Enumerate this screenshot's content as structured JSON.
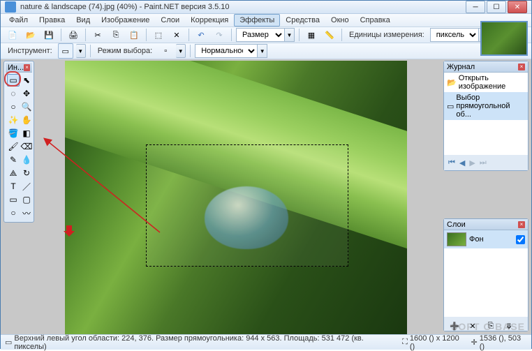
{
  "window": {
    "title": "nature & landscape (74).jpg (40%) - Paint.NET версия 3.5.10"
  },
  "menu": {
    "items": [
      "Файл",
      "Правка",
      "Вид",
      "Изображение",
      "Слои",
      "Коррекция",
      "Эффекты",
      "Средства",
      "Окно",
      "Справка"
    ],
    "active_index": 6
  },
  "toolbar1": {
    "size_label": "Размер от",
    "units_label": "Единицы измерения:",
    "units_value": "пикселы"
  },
  "toolbar2": {
    "instrument_label": "Инструмент:",
    "mode_label": "Режим выбора:",
    "normal_label": "Нормальное"
  },
  "tools": {
    "title": "Ин..."
  },
  "history": {
    "title": "Журнал",
    "items": [
      {
        "label": "Открыть изображение",
        "icon": "📂"
      },
      {
        "label": "Выбор прямоугольной об...",
        "icon": "▭"
      }
    ],
    "selected_index": 1
  },
  "layers": {
    "title": "Слои",
    "items": [
      {
        "name": "Фон",
        "visible": true
      }
    ]
  },
  "status": {
    "selection_info": "Верхний левый угол области: 224, 376. Размер прямоугольника: 944 x 563. Площадь: 531 472 (кв. пикселы)",
    "image_size": "1600 () x 1200 ()",
    "cursor_pos": "1536 (), 503 ()"
  },
  "watermark": "SOFT O BASE"
}
